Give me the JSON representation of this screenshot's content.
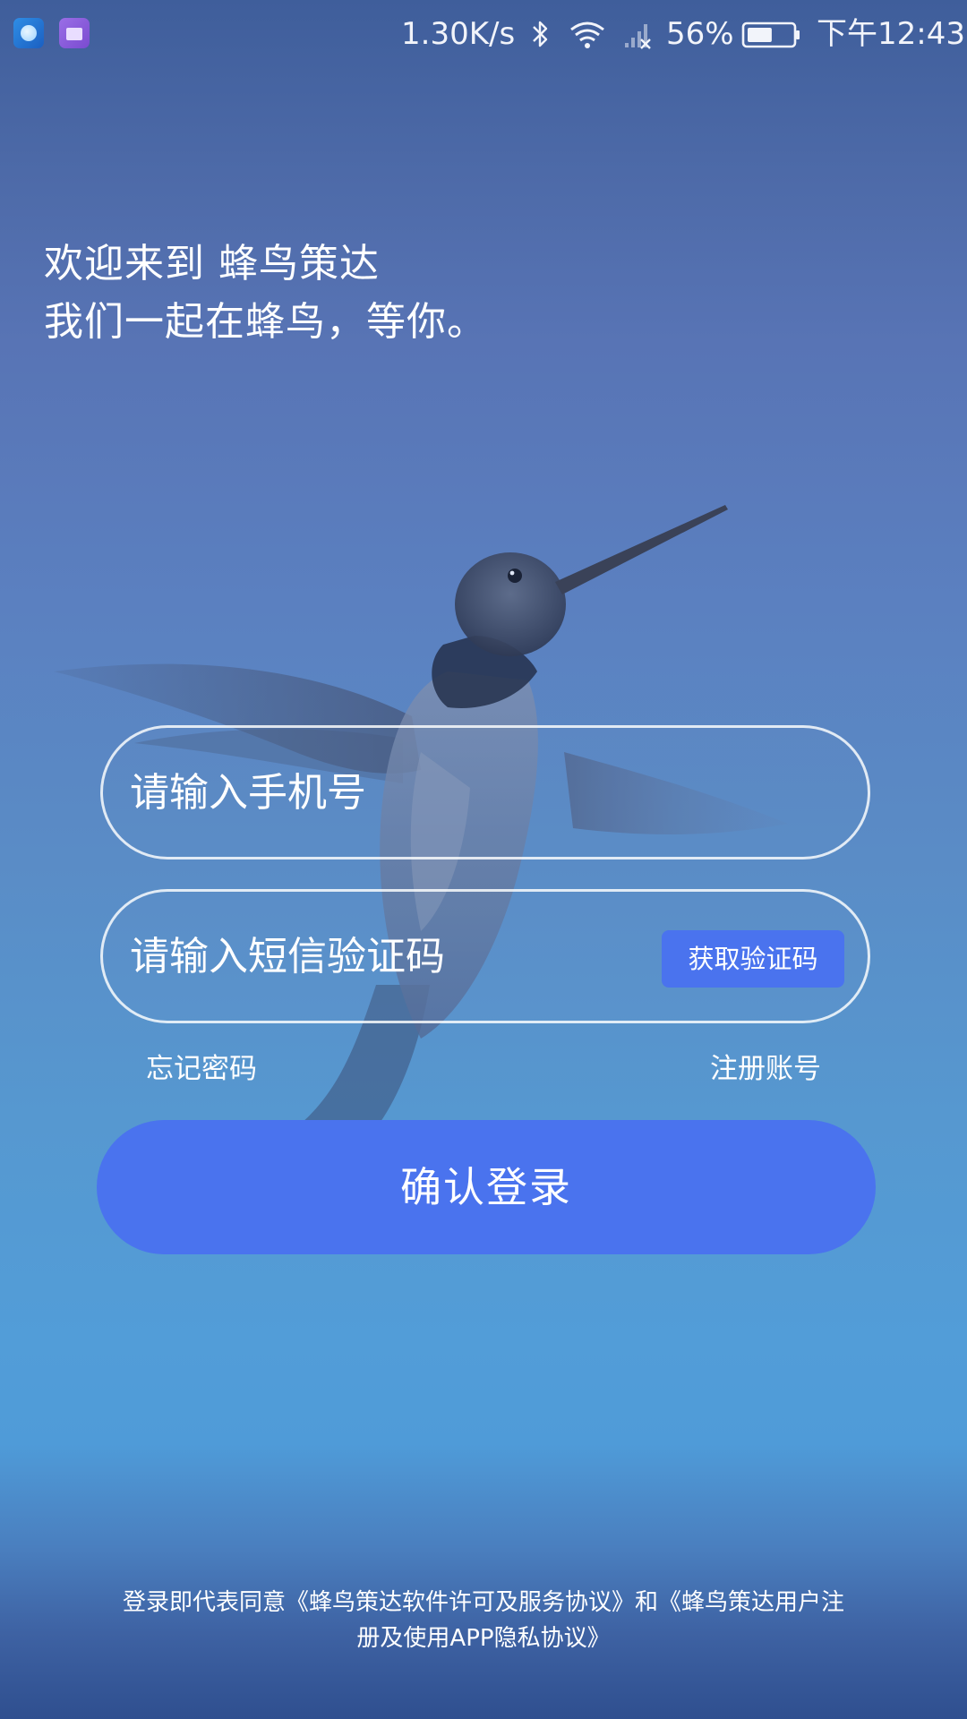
{
  "status_bar": {
    "net_speed": "1.30K/s",
    "battery_percent": "56%",
    "time": "下午12:43",
    "icons": [
      "browser-app-icon",
      "briefcase-app-icon",
      "bluetooth-icon",
      "wifi-icon",
      "signal-icon",
      "battery-icon"
    ],
    "battery_level": 0.56
  },
  "welcome": {
    "line1": "欢迎来到 蜂鸟策达",
    "line2": "我们一起在蜂鸟，等你。"
  },
  "form": {
    "phone_placeholder": "请输入手机号",
    "code_placeholder": "请输入短信验证码",
    "get_code_label": "获取验证码",
    "forgot_label": "忘记密码",
    "register_label": "注册账号",
    "login_label": "确认登录"
  },
  "agreement": {
    "line1": "登录即代表同意《蜂鸟策达软件许可及服务协议》和《蜂鸟策达用户注",
    "line2": "册及使用APP隐私协议》"
  },
  "colors": {
    "accent": "#4a73ee",
    "background_top": "#3f5e9b",
    "background_mid": "#5698d0",
    "background_bottom": "#2f4f8f"
  }
}
